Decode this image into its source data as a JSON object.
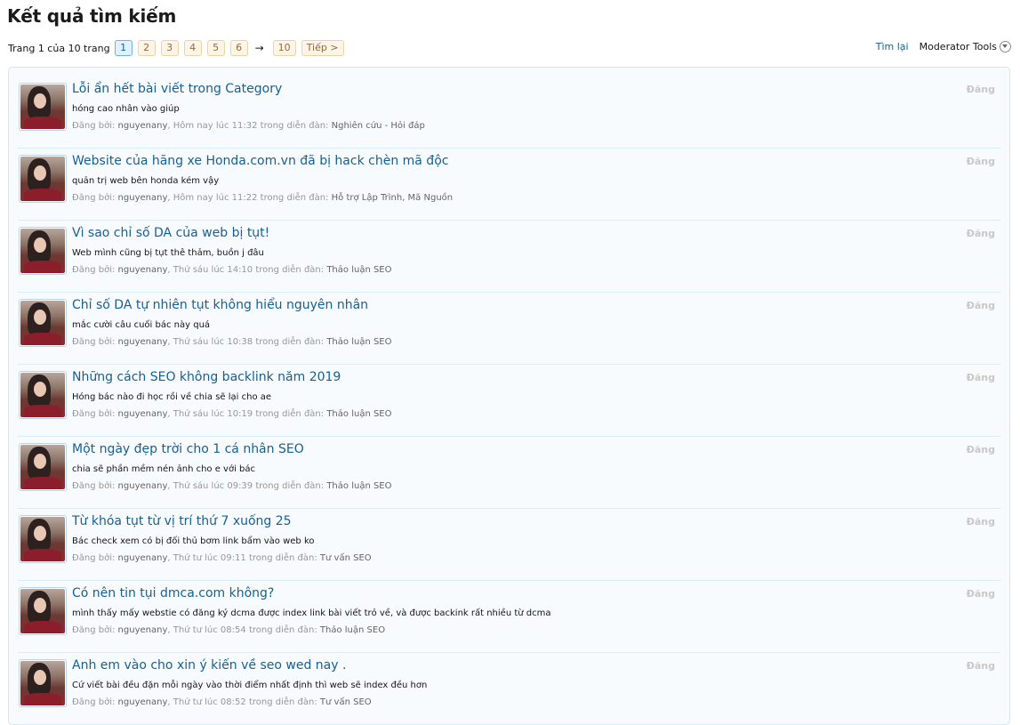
{
  "page": {
    "title": "Kết quả tìm kiếm"
  },
  "pagination": {
    "label": "Trang 1 của 10 trang",
    "pages": [
      "1",
      "2",
      "3",
      "4",
      "5",
      "6"
    ],
    "current": "1",
    "arrow": "→",
    "last": "10",
    "next": "Tiếp >"
  },
  "tools": {
    "find_again": "Tìm lại",
    "moderator": "Moderator Tools"
  },
  "meta_labels": {
    "posted_by": "Đăng bởi:",
    "in_forum": "trong diễn đàn:"
  },
  "results": [
    {
      "title": "Lỗi ẩn hết bài viết trong Category",
      "snippet": "hóng cao nhân vào giúp",
      "user": "nguyenany",
      "time": ", Hôm nay lúc 11:32",
      "forum": "Nghiên cứu - Hỏi đáp",
      "badge": "Đăng"
    },
    {
      "title": "Website của hãng xe Honda.com.vn đã bị hack chèn mã độc",
      "snippet": "quản trị web bên honda kém vậy",
      "user": "nguyenany",
      "time": ", Hôm nay lúc 11:22",
      "forum": "Hỗ trợ Lập Trình, Mã Nguồn",
      "badge": "Đăng"
    },
    {
      "title": "Vì sao chỉ số DA của web bị tụt!",
      "snippet": "Web mình cũng bị tụt thê thảm, buồn j đâu",
      "user": "nguyenany",
      "time": ", Thứ sáu lúc 14:10",
      "forum": "Thảo luận SEO",
      "badge": "Đăng"
    },
    {
      "title": "Chỉ số DA tự nhiên tụt không hiểu nguyên nhân",
      "snippet": "mắc cười câu cuối bác này quá",
      "user": "nguyenany",
      "time": ", Thứ sáu lúc 10:38",
      "forum": "Thảo luận SEO",
      "badge": "Đăng"
    },
    {
      "title": "Những cách SEO không backlink năm 2019",
      "snippet": "Hóng bác nào đi học rồi về chia sẽ lại cho ae",
      "user": "nguyenany",
      "time": ", Thứ sáu lúc 10:19",
      "forum": "Thảo luận SEO",
      "badge": "Đăng"
    },
    {
      "title": "Một ngày đẹp trời cho 1 cá nhân SEO",
      "snippet": "chia sẽ phần mềm nén ảnh cho e với bác",
      "user": "nguyenany",
      "time": ", Thứ sáu lúc 09:39",
      "forum": "Thảo luận SEO",
      "badge": "Đăng"
    },
    {
      "title": "Từ khóa tụt từ vị trí thứ 7 xuống 25",
      "snippet": "Bác check xem có bị đối thủ bơm link bẩm vào web ko",
      "user": "nguyenany",
      "time": ", Thứ tư lúc 09:11",
      "forum": "Tư vấn SEO",
      "badge": "Đăng"
    },
    {
      "title": "Có nên tin tụi dmca.com không?",
      "snippet": "mình thấy mấy webstie có đăng ký dcma được index link bài viết trỏ về, và được backink rất nhiều từ dcma",
      "user": "nguyenany",
      "time": ", Thứ tư lúc 08:54",
      "forum": "Thảo luận SEO",
      "badge": "Đăng"
    },
    {
      "title": "Anh em vào cho xin ý kiến về seo wed nay .",
      "snippet": "Cứ viết bài đều đặn mỗi ngày vào thời điểm nhất định thì web sẽ index đều hơn",
      "user": "nguyenany",
      "time": ", Thứ tư lúc 08:52",
      "forum": "Tư vấn SEO",
      "badge": "Đăng"
    }
  ]
}
